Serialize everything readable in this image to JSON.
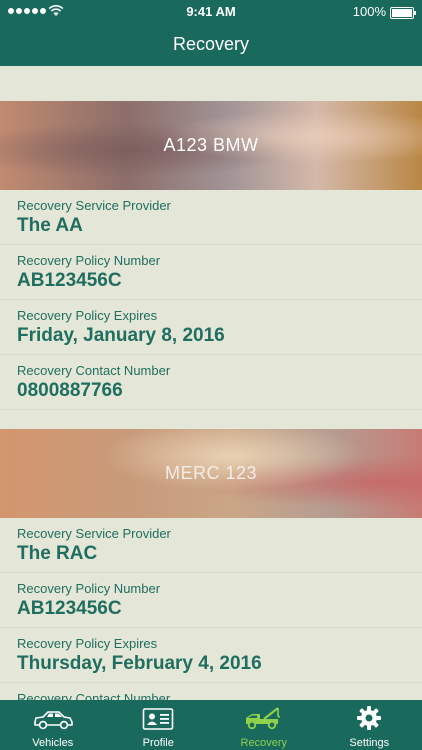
{
  "status_bar": {
    "time": "9:41 AM",
    "battery": "100%"
  },
  "header": {
    "title": "Recovery"
  },
  "vehicles": [
    {
      "name": "A123 BMW",
      "fields": [
        {
          "label": "Recovery Service Provider",
          "value": "The AA"
        },
        {
          "label": "Recovery Policy Number",
          "value": "AB123456C"
        },
        {
          "label": "Recovery Policy Expires",
          "value": "Friday, January 8, 2016"
        },
        {
          "label": "Recovery Contact Number",
          "value": "0800887766"
        }
      ]
    },
    {
      "name": "MERC 123",
      "fields": [
        {
          "label": "Recovery Service Provider",
          "value": "The RAC"
        },
        {
          "label": "Recovery Policy Number",
          "value": "AB123456C"
        },
        {
          "label": "Recovery Policy Expires",
          "value": "Thursday, February 4, 2016"
        },
        {
          "label": "Recovery Contact Number",
          "value": ""
        }
      ]
    }
  ],
  "tabs": [
    {
      "label": "Vehicles",
      "icon": "car-icon"
    },
    {
      "label": "Profile",
      "icon": "profile-card-icon"
    },
    {
      "label": "Recovery",
      "icon": "tow-truck-icon",
      "active": true
    },
    {
      "label": "Settings",
      "icon": "gear-icon"
    }
  ],
  "colors": {
    "primary": "#196a5c",
    "active_tab": "#8fd14a",
    "text": "#1f6e5f",
    "background": "#e4e6d8"
  }
}
